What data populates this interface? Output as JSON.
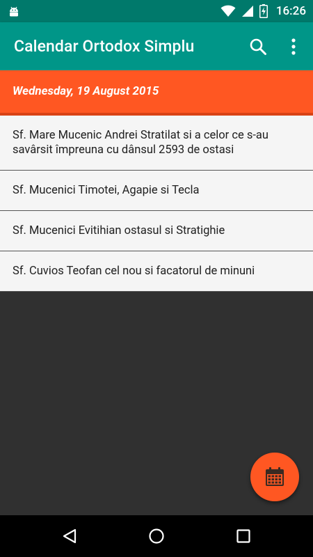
{
  "status_bar": {
    "time": "16:26",
    "left_icon": "android-debug-icon",
    "right_icons": [
      "wifi-icon",
      "signal-icon",
      "battery-charging-icon"
    ]
  },
  "app_bar": {
    "title": "Calendar Ortodox Simplu",
    "actions": [
      "search-icon",
      "overflow-menu-icon"
    ]
  },
  "date_header": {
    "label": "Wednesday, 19 August 2015"
  },
  "saints": [
    {
      "label": "Sf. Mare Mucenic Andrei Stratilat si a celor ce s-au savârsit împreuna cu dânsul 2593 de ostasi"
    },
    {
      "label": "Sf. Mucenici Timotei, Agapie si Tecla"
    },
    {
      "label": "Sf. Mucenici Evitihian ostasul si Stratighie"
    },
    {
      "label": "Sf. Cuvios Teofan cel nou si facatorul de minuni"
    }
  ],
  "fab": {
    "icon": "calendar-icon"
  },
  "nav_bar": {
    "buttons": [
      "back-icon",
      "home-icon",
      "recents-icon"
    ]
  },
  "colors": {
    "status_bar": "#00796B",
    "app_bar": "#009688",
    "accent": "#FF5722",
    "list_background": "#F5F5F5",
    "screen_background": "#303030"
  }
}
